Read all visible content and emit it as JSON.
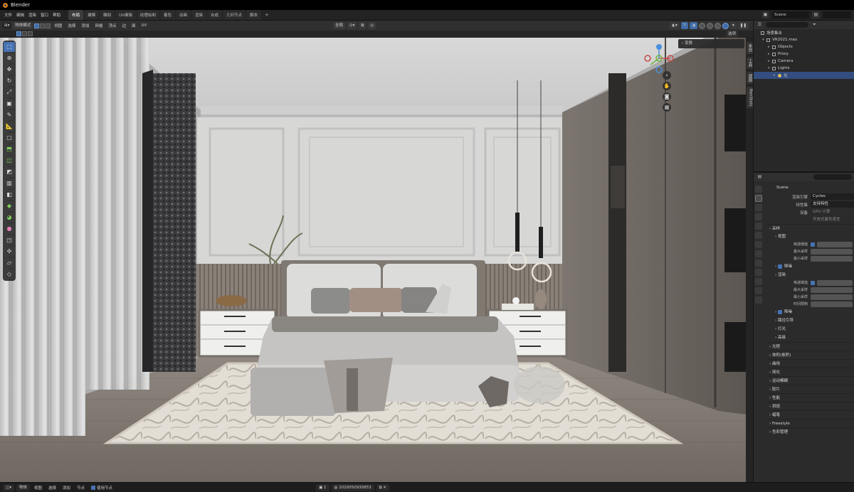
{
  "app": {
    "title": "Blender"
  },
  "menu": [
    "文件",
    "编辑",
    "渲染",
    "窗口",
    "帮助"
  ],
  "workspace_tabs": [
    {
      "label": "布局",
      "active": true
    },
    {
      "label": "建模",
      "active": false
    },
    {
      "label": "雕刻",
      "active": false
    },
    {
      "label": "UV编辑",
      "active": false
    },
    {
      "label": "纹理绘制",
      "active": false
    },
    {
      "label": "着色",
      "active": false
    },
    {
      "label": "动画",
      "active": false
    },
    {
      "label": "渲染",
      "active": false
    },
    {
      "label": "合成",
      "active": false
    },
    {
      "label": "几何节点",
      "active": false
    },
    {
      "label": "脚本",
      "active": false
    }
  ],
  "tab_add": "+",
  "top_right": {
    "scene": "Scene"
  },
  "viewport_header": {
    "mode": "物体模式",
    "menus": [
      "视图",
      "选择",
      "添加",
      "网格",
      "顶点",
      "边",
      "面",
      "UV"
    ],
    "orientation": "全局",
    "options": "选项"
  },
  "transform_panel": {
    "label": "变换"
  },
  "n_tabs": [
    "条目",
    "工具",
    "视图",
    "RenStats"
  ],
  "outliner": {
    "rows": [
      {
        "label": "场景集合",
        "indent": 0,
        "caret": "",
        "selected": false,
        "icon": "collection"
      },
      {
        "label": "VR2021.max",
        "indent": 1,
        "caret": "▾",
        "selected": false,
        "icon": "collection"
      },
      {
        "label": "Objects",
        "indent": 2,
        "caret": "▸",
        "selected": false,
        "icon": "collection"
      },
      {
        "label": "Proxy",
        "indent": 2,
        "caret": "▸",
        "selected": false,
        "icon": "collection"
      },
      {
        "label": "Camera",
        "indent": 2,
        "caret": "▸",
        "selected": false,
        "icon": "collection"
      },
      {
        "label": "Lights",
        "indent": 2,
        "caret": "▾",
        "selected": false,
        "icon": "collection"
      },
      {
        "label": "光",
        "indent": 3,
        "caret": "▸",
        "selected": true,
        "icon": "light"
      }
    ]
  },
  "properties": {
    "scene_name": "Scene",
    "render_engine_label": "渲染引擎",
    "render_engine": "Cycles",
    "feature_set_label": "特性集",
    "feature_set": "支持特性",
    "device_label": "设备",
    "device": "GPU 计算",
    "osl": "开放式着色语言",
    "sections": [
      {
        "label": "采样",
        "level": 0
      },
      {
        "label": "视图",
        "level": 1
      },
      {
        "label": "噪波阈值",
        "level": 2,
        "type": "check"
      },
      {
        "label": "最大采样",
        "level": 2,
        "type": "num"
      },
      {
        "label": "最小采样",
        "level": 2,
        "type": "num"
      },
      {
        "label": "降噪",
        "level": 1,
        "type": "check"
      },
      {
        "label": "渲染",
        "level": 1
      },
      {
        "label": "噪波阈值",
        "level": 2,
        "type": "check"
      },
      {
        "label": "最大采样",
        "level": 2,
        "type": "num"
      },
      {
        "label": "最小采样",
        "level": 2,
        "type": "num"
      },
      {
        "label": "时间限制",
        "level": 2,
        "type": "num"
      },
      {
        "label": "降噪",
        "level": 1,
        "type": "check"
      },
      {
        "label": "路径引导",
        "level": 1
      },
      {
        "label": "灯光",
        "level": 1
      },
      {
        "label": "高级",
        "level": 1
      },
      {
        "label": "光程",
        "level": 0
      },
      {
        "label": "体积(卷积)",
        "level": 0
      },
      {
        "label": "曲线",
        "level": 0
      },
      {
        "label": "简化",
        "level": 0
      },
      {
        "label": "运动模糊",
        "level": 0
      },
      {
        "label": "胶片",
        "level": 0
      },
      {
        "label": "性能",
        "level": 0
      },
      {
        "label": "烘焙",
        "level": 0
      },
      {
        "label": "蜡笔",
        "level": 0
      },
      {
        "label": "Freestyle",
        "level": 0
      },
      {
        "label": "色彩管理",
        "level": 0
      }
    ]
  },
  "statusbar": {
    "mode": "物体",
    "menus": [
      "视图",
      "选择",
      "添加",
      "节点"
    ],
    "use_nodes": "使用节点",
    "slot": "1",
    "material": "2020050930853"
  },
  "colors": {
    "accent": "#4772b3",
    "selected_row": "#334d80"
  }
}
